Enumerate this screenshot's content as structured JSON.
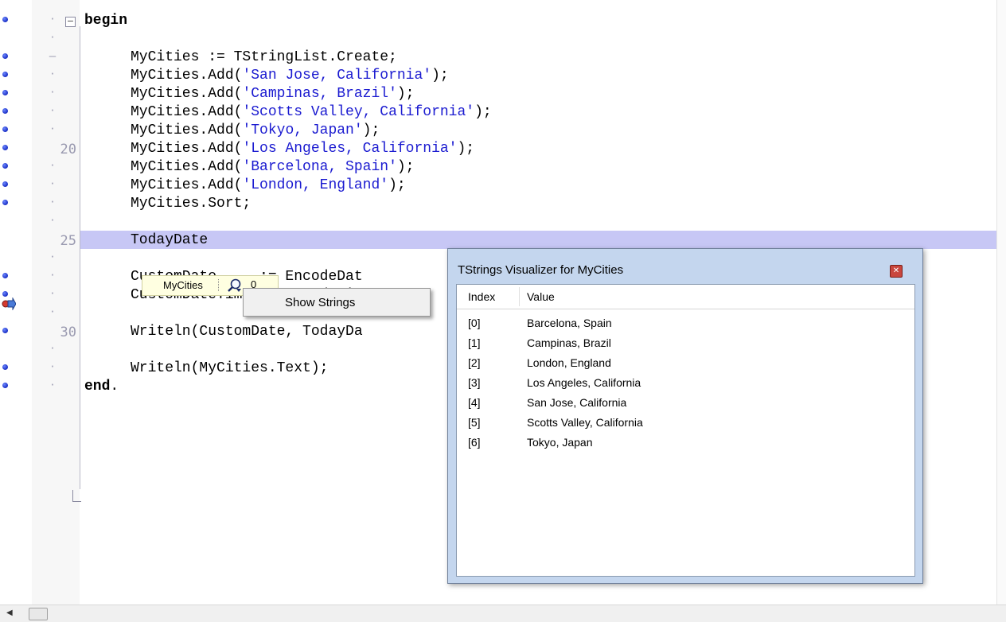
{
  "editor": {
    "lines": [
      {
        "num": "",
        "code": [
          {
            "t": "kw",
            "v": "begin"
          }
        ],
        "bp": true
      },
      {
        "num": "",
        "code": [],
        "bp": false
      },
      {
        "num": "",
        "code": [
          {
            "t": "p",
            "v": "MyCities := TStringList.Create;"
          }
        ],
        "bp": true
      },
      {
        "num": "",
        "code": [
          {
            "t": "p",
            "v": "MyCities.Add("
          },
          {
            "t": "s",
            "v": "'San Jose, California'"
          },
          {
            "t": "p",
            "v": ");"
          }
        ],
        "bp": true
      },
      {
        "num": "",
        "code": [
          {
            "t": "p",
            "v": "MyCities.Add("
          },
          {
            "t": "s",
            "v": "'Campinas, Brazil'"
          },
          {
            "t": "p",
            "v": ");"
          }
        ],
        "bp": true
      },
      {
        "num": "",
        "code": [
          {
            "t": "p",
            "v": "MyCities.Add("
          },
          {
            "t": "s",
            "v": "'Scotts Valley, California'"
          },
          {
            "t": "p",
            "v": ");"
          }
        ],
        "bp": true
      },
      {
        "num": "",
        "code": [
          {
            "t": "p",
            "v": "MyCities.Add("
          },
          {
            "t": "s",
            "v": "'Tokyo, Japan'"
          },
          {
            "t": "p",
            "v": ");"
          }
        ],
        "bp": true
      },
      {
        "num": "20",
        "code": [
          {
            "t": "p",
            "v": "MyCities.Add("
          },
          {
            "t": "s",
            "v": "'Los Angeles, California'"
          },
          {
            "t": "p",
            "v": ");"
          }
        ],
        "bp": true
      },
      {
        "num": "",
        "code": [
          {
            "t": "p",
            "v": "MyCities.Add("
          },
          {
            "t": "s",
            "v": "'Barcelona, Spain'"
          },
          {
            "t": "p",
            "v": ");"
          }
        ],
        "bp": true
      },
      {
        "num": "",
        "code": [
          {
            "t": "p",
            "v": "MyCities.Add("
          },
          {
            "t": "s",
            "v": "'London, England'"
          },
          {
            "t": "p",
            "v": ");"
          }
        ],
        "bp": true
      },
      {
        "num": "",
        "code": [
          {
            "t": "p",
            "v": "MyCities.Sort;"
          }
        ],
        "bp": true
      },
      {
        "num": "",
        "code": [],
        "bp": false
      },
      {
        "num": "25",
        "code": [
          {
            "t": "p",
            "v": "TodayDate"
          }
        ],
        "bp": false,
        "exec": true
      },
      {
        "num": "",
        "code": [],
        "bp": false
      },
      {
        "num": "",
        "code": [
          {
            "t": "p",
            "v": "CustomDate     := EncodeDat"
          }
        ],
        "bp": true
      },
      {
        "num": "",
        "code": [
          {
            "t": "p",
            "v": "CustomDateTime := EncodeTim"
          }
        ],
        "bp": true
      },
      {
        "num": "",
        "code": [],
        "bp": false
      },
      {
        "num": "30",
        "code": [
          {
            "t": "p",
            "v": "Writeln(CustomDate, TodayDa"
          }
        ],
        "bp": true
      },
      {
        "num": "",
        "code": [],
        "bp": false
      },
      {
        "num": "",
        "code": [
          {
            "t": "p",
            "v": "Writeln(MyCities.Text);"
          }
        ],
        "bp": true
      },
      {
        "num": "",
        "code": [
          {
            "t": "kw",
            "v": "end"
          },
          {
            "t": "p",
            "v": "."
          }
        ],
        "bp": true
      }
    ]
  },
  "hint": {
    "variable": "MyCities",
    "value": "0",
    "icon": "magnifier-icon"
  },
  "context_menu": {
    "item": "Show Strings"
  },
  "visualizer": {
    "title": "TStrings Visualizer for MyCities",
    "close_glyph": "✕",
    "columns": [
      "Index",
      "Value"
    ],
    "rows": [
      {
        "index": "[0]",
        "value": "Barcelona, Spain"
      },
      {
        "index": "[1]",
        "value": "Campinas, Brazil"
      },
      {
        "index": "[2]",
        "value": "London, England"
      },
      {
        "index": "[3]",
        "value": "Los Angeles, California"
      },
      {
        "index": "[4]",
        "value": "San Jose, California"
      },
      {
        "index": "[5]",
        "value": "Scotts Valley, California"
      },
      {
        "index": "[6]",
        "value": "Tokyo, Japan"
      }
    ]
  },
  "scrollbar": {
    "left_arrow": "◀"
  },
  "colors": {
    "exec_highlight": "#c7c7f5",
    "string_literal": "#1a1ad0",
    "breakpoint": "#1a2fc4"
  }
}
